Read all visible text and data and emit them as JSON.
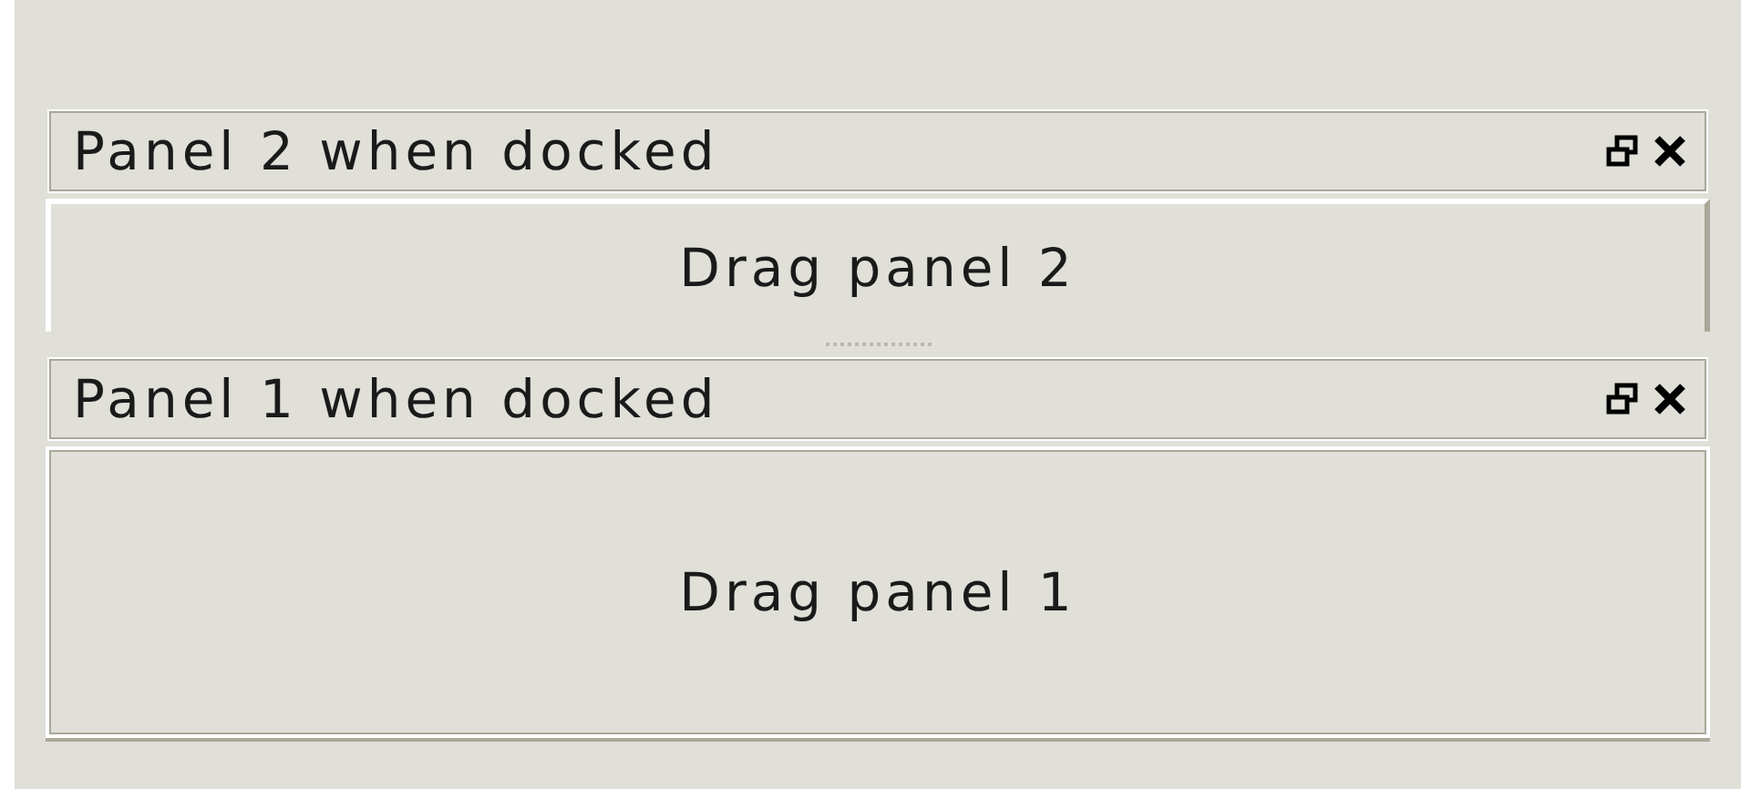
{
  "panels": [
    {
      "title": "Panel 2 when docked",
      "content": "Drag panel 2",
      "kind": "raised"
    },
    {
      "title": "Panel 1 when docked",
      "content": "Drag panel 1",
      "kind": "sunken"
    }
  ]
}
